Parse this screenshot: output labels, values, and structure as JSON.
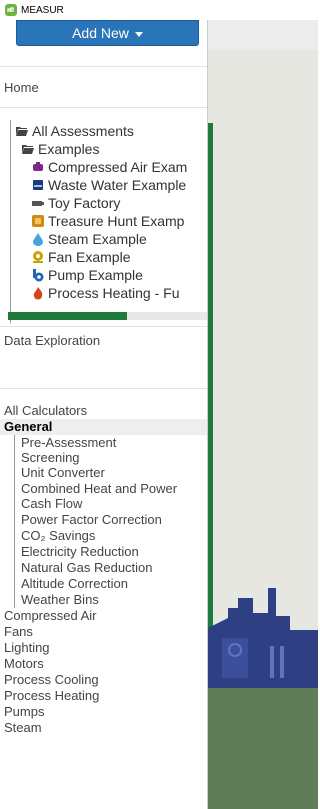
{
  "window": {
    "title": "MEASUR"
  },
  "sidebar": {
    "add_new_label": "Add New",
    "home_label": "Home",
    "data_exploration_label": "Data Exploration",
    "tree": [
      {
        "label": "All Assessments",
        "icon": "folder-open-icon"
      },
      {
        "label": "Examples",
        "icon": "folder-open-icon"
      },
      {
        "label": "Compressed Air Exam",
        "icon": "compressed-air-icon",
        "color": "#7b2a8a"
      },
      {
        "label": "Waste Water Example",
        "icon": "waste-water-icon",
        "color": "#1c3b7a"
      },
      {
        "label": "Toy Factory",
        "icon": "battery-icon",
        "color": "#555555"
      },
      {
        "label": "Treasure Hunt Examp",
        "icon": "treasure-hunt-icon",
        "color": "#d08a1a"
      },
      {
        "label": "Steam Example",
        "icon": "steam-icon",
        "color": "#4aa3df"
      },
      {
        "label": "Fan Example",
        "icon": "fan-icon",
        "color": "#c9a400"
      },
      {
        "label": "Pump Example",
        "icon": "pump-icon",
        "color": "#1f66b5"
      },
      {
        "label": "Process Heating - Fu",
        "icon": "flame-icon",
        "color": "#d8431a"
      }
    ],
    "progress_fraction": 0.6,
    "calculators": {
      "all_label": "All Calculators",
      "general_label": "General",
      "general_items": [
        "Pre-Assessment Screening",
        "Unit Converter",
        "Combined Heat and Power",
        "Cash Flow",
        "Power Factor Correction",
        "CO₂ Savings",
        "Electricity Reduction",
        "Natural Gas Reduction",
        "Altitude Correction",
        "Weather Bins"
      ],
      "categories": [
        "Compressed Air",
        "Fans",
        "Lighting",
        "Motors",
        "Process Cooling",
        "Process Heating",
        "Pumps",
        "Steam"
      ]
    }
  },
  "colors": {
    "accent_blue": "#2a75b9",
    "accent_green": "#1e7a3c",
    "factory_blue": "#2f3f84"
  }
}
